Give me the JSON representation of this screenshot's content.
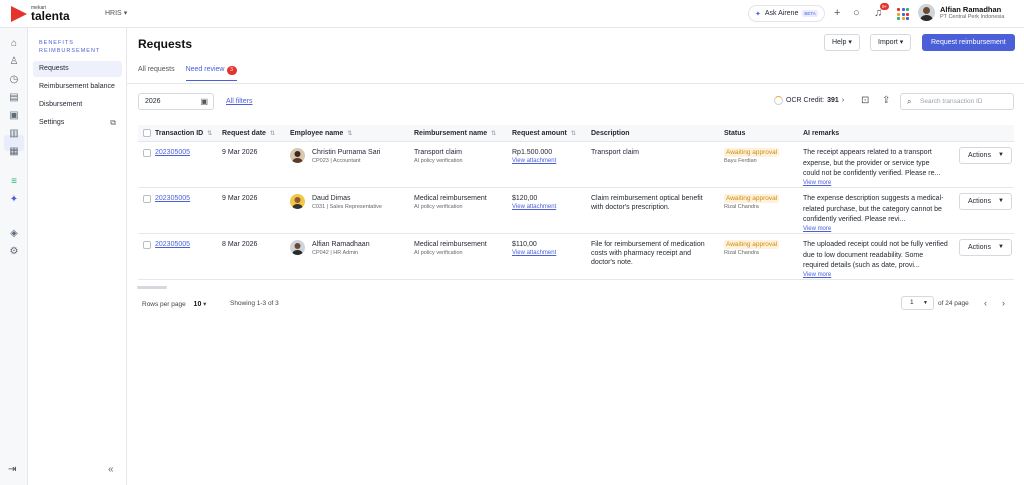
{
  "brand": {
    "small": "mekari",
    "name": "talenta"
  },
  "module_switch": "HRIS",
  "ask": {
    "label": "Ask Airene",
    "beta": "BETA"
  },
  "notification_count": "9+",
  "user": {
    "name": "Alfian Ramadhan",
    "company": "PT Central Perk Indonesia"
  },
  "subnav": {
    "title": "BENEFITS REIMBURSEMENT",
    "items": [
      {
        "label": "Requests"
      },
      {
        "label": "Reimbursement balance"
      },
      {
        "label": "Disbursement"
      },
      {
        "label": "Settings"
      }
    ]
  },
  "page": {
    "title": "Requests",
    "help": "Help",
    "import": "Import",
    "request_btn": "Request reimbursement"
  },
  "tabs": [
    {
      "label": "All requests"
    },
    {
      "label": "Need review",
      "badge": "3"
    }
  ],
  "filters": {
    "year": "2026",
    "all_filters": "All filters",
    "ocr_label": "OCR Credit:",
    "ocr_value": "391",
    "search_placeholder": "Search transaction ID"
  },
  "table": {
    "headers": [
      "Transaction ID",
      "Request date",
      "Employee name",
      "Reimbursement name",
      "Request amount",
      "Description",
      "Status",
      "AI remarks"
    ],
    "rows": [
      {
        "id": "202305005",
        "date": "9 Mar 2026",
        "name": "Christin Purnama Sari",
        "emp_sub": "CP023 | Accountant",
        "reimb": "Transport claim",
        "reimb_sub": "AI policy verification",
        "amount": "Rp1.500.000",
        "attach": "View attachment",
        "desc": "Transport claim",
        "status": "Awaiting approval",
        "approver": "Bayu Ferdian",
        "remark": "The receipt appears related to a transport expense, but the provider or service type could not be confidently verified. Please re...",
        "view_more": "View more",
        "actions": "Actions"
      },
      {
        "id": "202305005",
        "date": "9 Mar 2026",
        "name": "Daud Dimas",
        "emp_sub": "C031 | Sales Representative",
        "reimb": "Medical reimbursement",
        "reimb_sub": "AI policy verification",
        "amount": "$120,00",
        "attach": "View attachment",
        "desc": "Claim reimbursement optical benefit with doctor's prescription.",
        "status": "Awaiting approval",
        "approver": "Rizal Chandra",
        "remark": "The expense description suggests a medical-related purchase, but the category cannot be confidently verified. Please revi...",
        "view_more": "View more",
        "actions": "Actions"
      },
      {
        "id": "202305005",
        "date": "8 Mar 2026",
        "name": "Alfian Ramadhaan",
        "emp_sub": "CP042 | HR Admin",
        "reimb": "Medical reimbursement",
        "reimb_sub": "AI policy verification",
        "amount": "$110,00",
        "attach": "View attachment",
        "desc": "File for reimbursement of medication costs with pharmacy receipt and doctor's note.",
        "status": "Awaiting approval",
        "approver": "Rizal Chandra",
        "remark": "The uploaded receipt could not be fully verified due to low document readability. Some required details (such as date, provi...",
        "view_more": "View more",
        "actions": "Actions"
      }
    ]
  },
  "footer": {
    "rows_per_page_label": "Rows per page",
    "rows_per_page": "10",
    "showing": "Showing 1-3 of 3",
    "page": "1",
    "of_pages": "of 24 page"
  },
  "colors": {
    "accent": "#4a5fd8",
    "brand": "#e5322d",
    "awaiting": "#d08a10"
  }
}
